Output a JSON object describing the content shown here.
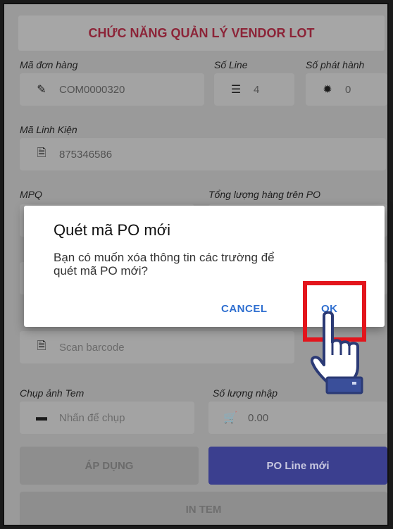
{
  "header": {
    "title": "CHỨC NĂNG QUẢN LÝ VENDOR LOT"
  },
  "form": {
    "order_label": "Mã đơn hàng",
    "order_value": "COM0000320",
    "line_label": "Số Line",
    "line_value": "4",
    "issue_label": "Số phát hành",
    "issue_value": "0",
    "part_label": "Mã Linh Kiện",
    "part_value": "875346586",
    "mpq_label": "MPQ",
    "total_label": "Tổng lượng hàng trên PO",
    "barcode_placeholder": "Scan barcode",
    "photo_label": "Chụp ảnh Tem",
    "photo_placeholder": "Nhấn để chụp",
    "qty_label": "Số lượng nhập",
    "qty_value": "0.00"
  },
  "buttons": {
    "apply": "ÁP DỤNG",
    "new_po_line": "PO Line mới",
    "print": "IN TEM"
  },
  "dialog": {
    "title": "Quét mã PO mới",
    "message": "Bạn có muốn xóa thông tin các trường để quét mã PO mới?",
    "cancel": "CANCEL",
    "ok": "OK"
  },
  "colors": {
    "title_text": "#8c2438",
    "primary_button": "#3b3f8f",
    "dialog_action": "#2f6fd0",
    "highlight": "#e3151c"
  },
  "icons": [
    "edit-icon",
    "list-icon",
    "gear-icon",
    "document-icon",
    "image-icon",
    "cart-icon",
    "pointer-hand-icon"
  ]
}
